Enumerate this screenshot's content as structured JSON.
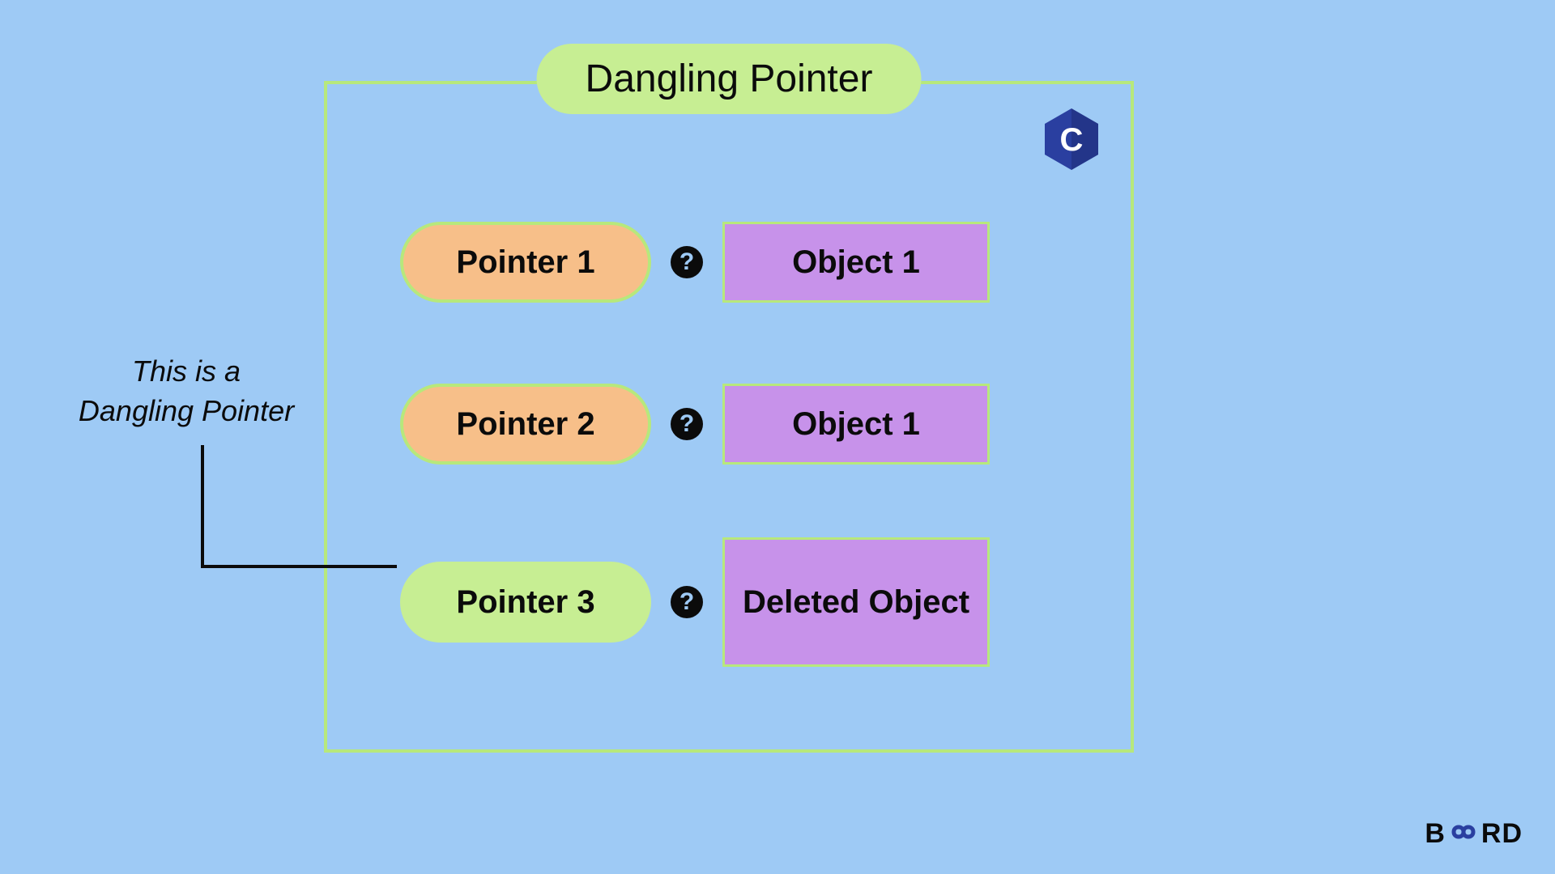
{
  "title": "Dangling Pointer",
  "logo_letter": "C",
  "rows": [
    {
      "pointer": "Pointer 1",
      "object": "Object 1",
      "pointer_style": "orange",
      "object_tall": false
    },
    {
      "pointer": "Pointer 2",
      "object": "Object 1",
      "pointer_style": "orange",
      "object_tall": false
    },
    {
      "pointer": "Pointer 3",
      "object": "Deleted Object",
      "pointer_style": "green",
      "object_tall": true
    }
  ],
  "annotation_line1": "This is a",
  "annotation_line2": "Dangling Pointer",
  "question_glyph": "?",
  "footer": {
    "b": "B",
    "rd": "RD"
  },
  "colors": {
    "bg": "#9ecaf5",
    "frame_border": "#b7e87c",
    "pill_green": "#c7ee93",
    "pill_orange": "#f7bf89",
    "object_purple": "#c792ea",
    "hex": "#2a3fa0"
  }
}
